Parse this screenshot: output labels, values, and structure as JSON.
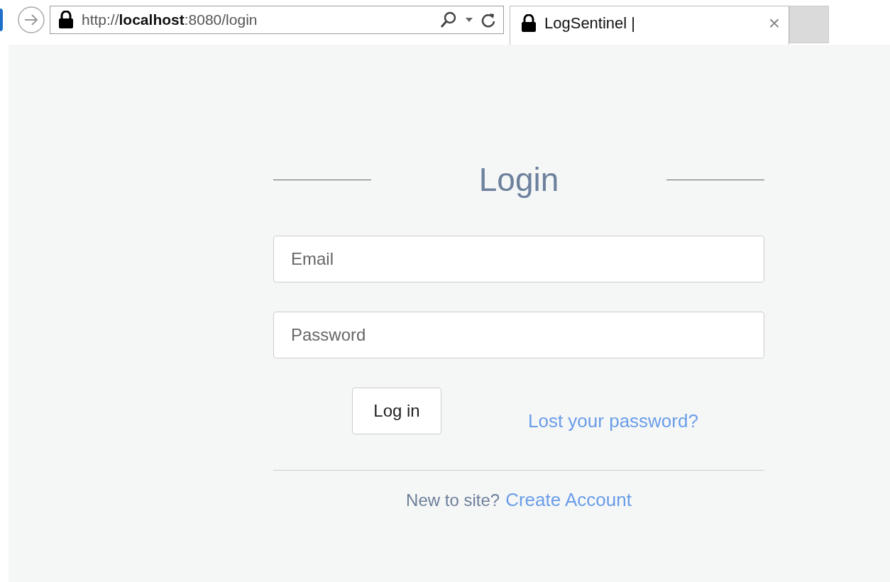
{
  "browser": {
    "address": "http://**localhost**:8080/login",
    "tab": {
      "title": "LogSentinel |",
      "close": "×",
      "selected": true
    }
  },
  "login": {
    "title": "Login",
    "fields": [
      {
        "placeholder": "Email"
      },
      {
        "placeholder": "Password"
      }
    ],
    "submit": "Log in",
    "lost_password": "Lost your password?",
    "footer": {
      "text": "New to site?",
      "link": "Create Account"
    }
  }
}
